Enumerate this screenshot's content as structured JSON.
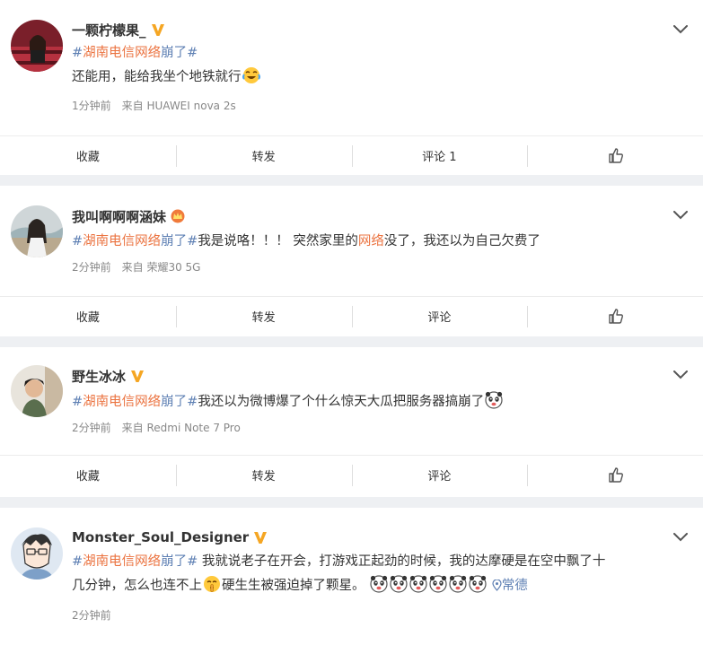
{
  "colors": {
    "topic": "#eb7340",
    "link": "#5d7fb3",
    "vip": "#f5a623",
    "text": "#333333",
    "meta": "#888888",
    "background": "#eef0f3"
  },
  "actions": {
    "favorite": "收藏",
    "repost": "转发",
    "comment": "评论"
  },
  "posts": [
    {
      "username": "一颗柠檬果_",
      "badge": "vip-v-icon",
      "hash_open": "#",
      "topic_main": "湖南电信网络",
      "topic_sub": "崩了",
      "hash_close": "#",
      "body": "还能用，能给我坐个地铁就行",
      "emoji": "laugh-cry-emoji",
      "time": "1分钟前",
      "source": "来自 HUAWEI nova 2s",
      "comment_label": "评论 1"
    },
    {
      "username": "我叫啊啊啊涵妹",
      "badge": "crown-badge-icon",
      "hash_open": "#",
      "topic_main": "湖南电信网络",
      "topic_sub": "崩了",
      "hash_close": "#",
      "body_before": "我是说咯！！！ 突然家里的",
      "body_keyword": "网络",
      "body_after": "没了，我还以为自己欠费了",
      "time": "2分钟前",
      "source": "来自 荣耀30 5G",
      "comment_label": "评论"
    },
    {
      "username": "野生冰冰",
      "badge": "vip-v-icon",
      "hash_open": "#",
      "topic_main": "湖南电信网络",
      "topic_sub": "崩了",
      "hash_close": "#",
      "body": "我还以为微博爆了个什么惊天大瓜把服务器搞崩了",
      "emoji": "panda-emoji",
      "time": "2分钟前",
      "source": "来自 Redmi Note 7 Pro",
      "comment_label": "评论"
    },
    {
      "username": "Monster_Soul_Designer",
      "badge": "vip-v-icon",
      "hash_open": "#",
      "topic_main": "湖南电信网络",
      "topic_sub": "崩了",
      "hash_close": "#",
      "body_line1": " 我就说老子在开会，打游戏正起劲的时候，我的达摩硬是在空中飘了十",
      "body_line2a": "几分钟，怎么也连不上",
      "emoji_mid": "shush-emoji",
      "body_line2b": "硬生生被强迫掉了颗星。",
      "emoji_trail": [
        "panda-emoji",
        "panda-emoji",
        "panda-emoji",
        "panda-emoji",
        "panda-emoji",
        "panda-emoji"
      ],
      "location": "常德",
      "time": "2分钟前"
    }
  ]
}
